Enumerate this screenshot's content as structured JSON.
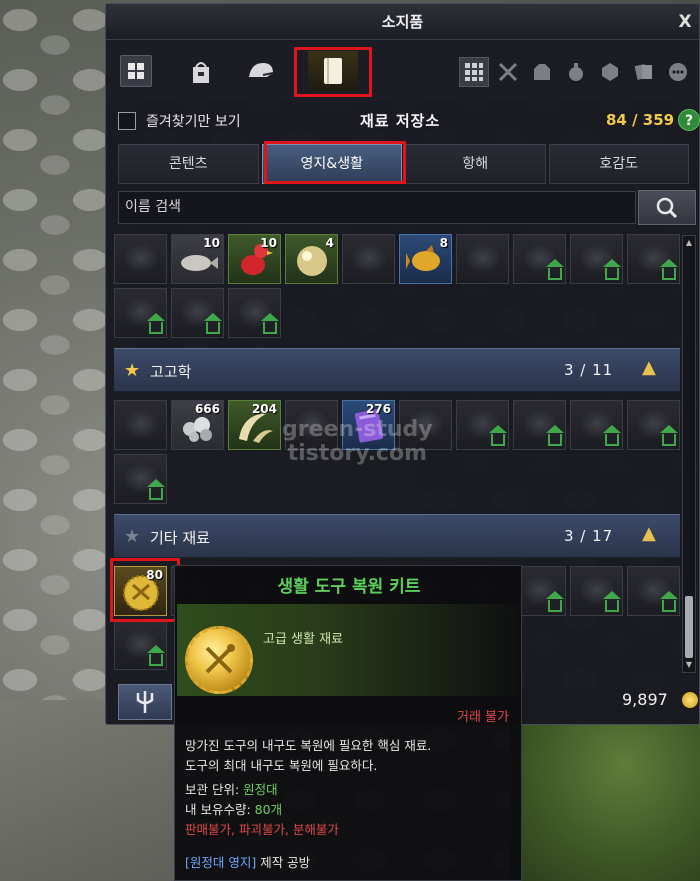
{
  "window": {
    "title": "소지품",
    "close": "X"
  },
  "filter": {
    "favorites_label": "즐겨찾기만 보기",
    "storage_title": "재료 저장소",
    "count": "84 / 359",
    "help": "?"
  },
  "category_tabs": [
    "콘텐츠",
    "영지&생활",
    "항해",
    "호감도"
  ],
  "search": {
    "placeholder": "이름 검색"
  },
  "quantities": {
    "fish": "10",
    "red_bird": "10",
    "pearl": "4",
    "gold_fish": "8",
    "ore": "666",
    "tusk": "204",
    "purple_book": "276",
    "kit": "80"
  },
  "sections": {
    "archaeology": {
      "name": "고고학",
      "count": "3  /  11"
    },
    "misc": {
      "name": "기타 재료",
      "count": "3  /  17"
    }
  },
  "bottom": {
    "silver": "9,897"
  },
  "tooltip": {
    "title": "생활 도구 복원 키트",
    "grade": "고급 생활 재료",
    "trade": "거래 불가",
    "desc1": "망가진 도구의 내구도 복원에 필요한 핵심 재료.",
    "desc2": "도구의 최대 내구도 복원에 필요하다.",
    "storage_label": "보관 단위: ",
    "storage_value": "원정대",
    "owned_label": "내 보유수량: ",
    "owned_value": "80개",
    "restrictions": "판매불가, 파괴불가, 분해불가",
    "source_tag": "[원정대 영지]",
    "source_text": " 제작 공방"
  },
  "watermark": {
    "line1": "green-study",
    "line2": "tistory.com"
  },
  "colors": {
    "highlight_red": "#e0151b",
    "gold": "#f2c94c",
    "green_text": "#5cd05a"
  }
}
